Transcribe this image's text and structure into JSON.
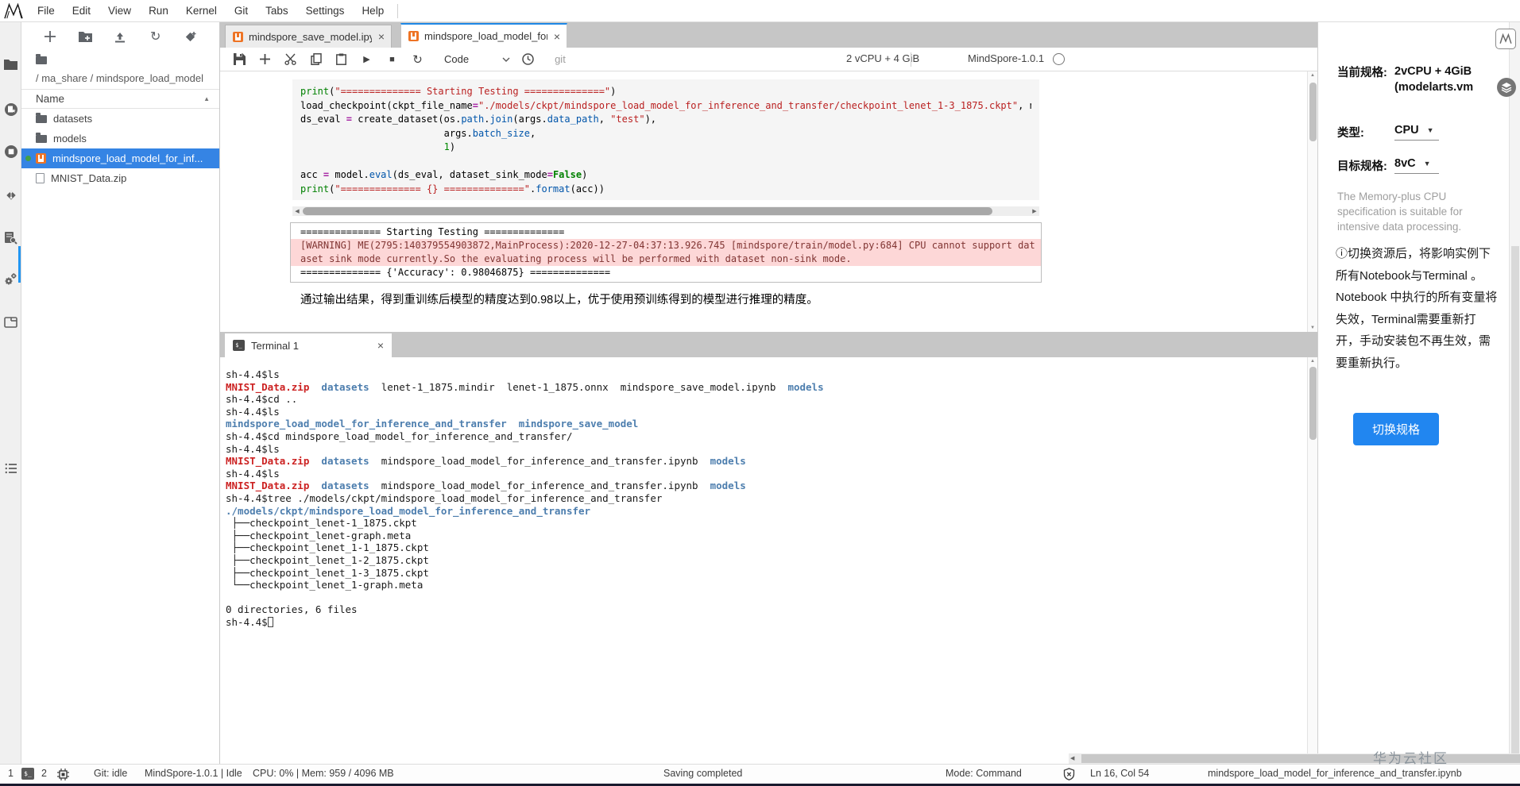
{
  "menu_bar": {
    "items": [
      "File",
      "Edit",
      "View",
      "Run",
      "Kernel",
      "Git",
      "Tabs",
      "Settings",
      "Help"
    ]
  },
  "file_browser": {
    "breadcrumb": "/ ma_share / mindspore_load_model",
    "column_header": "Name",
    "items": [
      {
        "label": "datasets",
        "type": "folder",
        "selected": false,
        "running": false
      },
      {
        "label": "models",
        "type": "folder",
        "selected": false,
        "running": false
      },
      {
        "label": "mindspore_load_model_for_inf...",
        "type": "notebook",
        "selected": true,
        "running": true
      },
      {
        "label": "MNIST_Data.zip",
        "type": "file",
        "selected": false,
        "running": false
      }
    ]
  },
  "doc_tabs": [
    {
      "label": "mindspore_save_model.ipynb",
      "active": false
    },
    {
      "label": "mindspore_load_model_for_i",
      "active": true
    }
  ],
  "notebook_toolbar": {
    "cell_type": "Code",
    "git_label": "git",
    "resource_spec": "2 vCPU + 4 GiB",
    "kernel_name": "MindSpore-1.0.1"
  },
  "code_cell": {
    "lines": [
      [
        [
          "b",
          "print"
        ],
        [
          "t",
          "("
        ],
        [
          "s",
          "\"============== Starting Testing ==============\""
        ],
        [
          "t",
          ")"
        ]
      ],
      [
        [
          "t",
          "load_checkpoint(ckpt_file_name"
        ],
        [
          "o",
          "="
        ],
        [
          "s",
          "\"./models/ckpt/mindspore_load_model_for_inference_and_transfer/checkpoint_lenet_1-3_1875.ckpt\""
        ],
        [
          "t",
          ", n"
        ]
      ],
      [
        [
          "t",
          "ds_eval "
        ],
        [
          "o",
          "="
        ],
        [
          "t",
          " create_dataset(os."
        ],
        [
          "p",
          "path"
        ],
        [
          "t",
          "."
        ],
        [
          "p",
          "join"
        ],
        [
          "t",
          "(args."
        ],
        [
          "p",
          "data_path"
        ],
        [
          "t",
          ", "
        ],
        [
          "s",
          "\"test\""
        ],
        [
          "t",
          "),"
        ]
      ],
      [
        [
          "t",
          "                         args."
        ],
        [
          "p",
          "batch_size"
        ],
        [
          "t",
          ","
        ]
      ],
      [
        [
          "t",
          "                         "
        ],
        [
          "n",
          "1"
        ],
        [
          "t",
          ")"
        ]
      ],
      [],
      [
        [
          "t",
          "acc "
        ],
        [
          "o",
          "="
        ],
        [
          "t",
          " model."
        ],
        [
          "p",
          "eval"
        ],
        [
          "t",
          "(ds_eval, dataset_sink_mode"
        ],
        [
          "o",
          "="
        ],
        [
          "k",
          "False"
        ],
        [
          "t",
          ")"
        ]
      ],
      [
        [
          "b",
          "print"
        ],
        [
          "t",
          "("
        ],
        [
          "s",
          "\"============== {} ==============\""
        ],
        [
          "t",
          "."
        ],
        [
          "p",
          "format"
        ],
        [
          "t",
          "(acc))"
        ]
      ]
    ]
  },
  "cell_output": {
    "line_start": "============== Starting Testing ==============",
    "warning_lines": [
      "[WARNING] ME(2795:140379554903872,MainProcess):2020-12-27-04:37:13.926.745 [mindspore/train/model.py:684] CPU cannot support dat",
      "aset sink mode currently.So the evaluating process will be performed with dataset non-sink mode."
    ],
    "line_result": "============== {'Accuracy': 0.98046875} =============="
  },
  "markdown_note": "通过输出结果，得到重训练后模型的精度达到0.98以上，优于使用预训练得到的模型进行推理的精度。",
  "terminal": {
    "tab_label": "Terminal 1",
    "lines": [
      [
        [
          "d",
          "sh-4.4$ls"
        ]
      ],
      [
        [
          "a",
          "MNIST_Data.zip"
        ],
        [
          "d",
          "  "
        ],
        [
          "dir",
          "datasets"
        ],
        [
          "d",
          "  lenet-1_1875.mindir  lenet-1_1875.onnx  mindspore_save_model.ipynb  "
        ],
        [
          "dir",
          "models"
        ]
      ],
      [
        [
          "d",
          "sh-4.4$cd .."
        ]
      ],
      [
        [
          "d",
          "sh-4.4$ls"
        ]
      ],
      [
        [
          "dir",
          "mindspore_load_model_for_inference_and_transfer"
        ],
        [
          "d",
          "  "
        ],
        [
          "dir",
          "mindspore_save_model"
        ]
      ],
      [
        [
          "d",
          "sh-4.4$cd mindspore_load_model_for_inference_and_transfer/"
        ]
      ],
      [
        [
          "d",
          "sh-4.4$ls"
        ]
      ],
      [
        [
          "a",
          "MNIST_Data.zip"
        ],
        [
          "d",
          "  "
        ],
        [
          "dir",
          "datasets"
        ],
        [
          "d",
          "  mindspore_load_model_for_inference_and_transfer.ipynb  "
        ],
        [
          "dir",
          "models"
        ]
      ],
      [
        [
          "d",
          "sh-4.4$ls"
        ]
      ],
      [
        [
          "a",
          "MNIST_Data.zip"
        ],
        [
          "d",
          "  "
        ],
        [
          "dir",
          "datasets"
        ],
        [
          "d",
          "  mindspore_load_model_for_inference_and_transfer.ipynb  "
        ],
        [
          "dir",
          "models"
        ]
      ],
      [
        [
          "d",
          "sh-4.4$tree ./models/ckpt/mindspore_load_model_for_inference_and_transfer"
        ]
      ],
      [
        [
          "dir",
          "./models/ckpt/mindspore_load_model_for_inference_and_transfer"
        ]
      ],
      [
        [
          "d",
          " ├──checkpoint_lenet-1_1875.ckpt"
        ]
      ],
      [
        [
          "d",
          " ├──checkpoint_lenet-graph.meta"
        ]
      ],
      [
        [
          "d",
          " ├──checkpoint_lenet_1-1_1875.ckpt"
        ]
      ],
      [
        [
          "d",
          " ├──checkpoint_lenet_1-2_1875.ckpt"
        ]
      ],
      [
        [
          "d",
          " ├──checkpoint_lenet_1-3_1875.ckpt"
        ]
      ],
      [
        [
          "d",
          " └──checkpoint_lenet_1-graph.meta"
        ]
      ],
      [],
      [
        [
          "d",
          "0 directories, 6 files"
        ]
      ],
      [
        [
          "d",
          "sh-4.4$"
        ],
        [
          "cur",
          ""
        ]
      ]
    ]
  },
  "right_panel": {
    "current_spec_label": "当前规格:",
    "current_spec_value": "2vCPU + 4GiB (modelarts.vm",
    "type_label": "类型:",
    "type_value": "CPU",
    "target_spec_label": "目标规格:",
    "target_spec_value": "8vC",
    "description": "The Memory-plus CPU specification is suitable for intensive data processing.",
    "notice": "切换资源后，将影响实例下所有Notebook与Terminal 。 Notebook 中执行的所有变量将失效，Terminal需要重新打开，手动安装包不再生效，需要重新执行。",
    "switch_button": "切换规格"
  },
  "status_bar": {
    "terminals_count": "1",
    "kernels_count": "2",
    "git_status": "Git: idle",
    "kernel_status": "MindSpore-1.0.1 | Idle",
    "resources": "CPU: 0% | Mem: 959 / 4096 MB",
    "save_status": "Saving completed",
    "mode": "Mode: Command",
    "cursor_position": "Ln 16, Col 54",
    "active_file": "mindspore_load_model_for_inference_and_transfer.ipynb"
  },
  "watermark": "华为云社区",
  "icons": {
    "close": "×",
    "sort_caret": "▲",
    "run": "▶",
    "stop": "■",
    "restart": "↻",
    "select_caret": "▼",
    "scroll_left": "◀",
    "scroll_up": "▲",
    "scroll_down": "▼",
    "scroll_prev": "◀",
    "scroll_next": "▶",
    "info": "ⓘ",
    "terminal_badge": "$_"
  }
}
